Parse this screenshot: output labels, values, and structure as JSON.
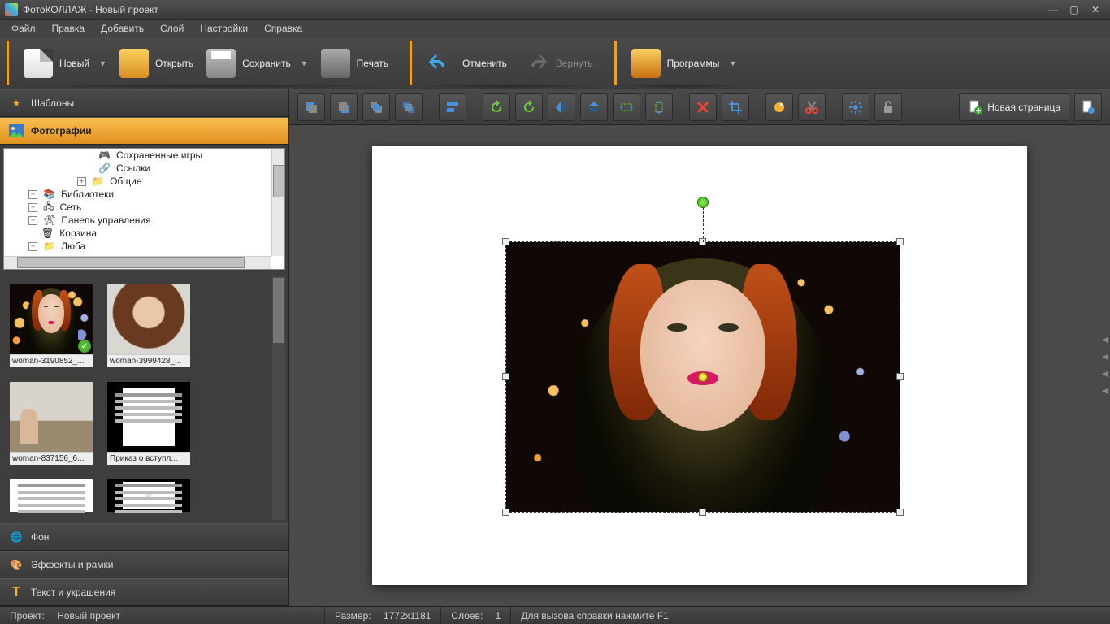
{
  "titlebar": {
    "app": "ФотоКОЛЛАЖ",
    "project": "Новый проект"
  },
  "menu": [
    "Файл",
    "Правка",
    "Добавить",
    "Слой",
    "Настройки",
    "Справка"
  ],
  "toolbar": {
    "new": "Новый",
    "open": "Открыть",
    "save": "Сохранить",
    "print": "Печать",
    "undo": "Отменить",
    "redo": "Вернуть",
    "programs": "Программы"
  },
  "sidebar": {
    "templates": "Шаблоны",
    "photos": "Фотографии",
    "background": "Фон",
    "effects": "Эффекты и рамки",
    "text": "Текст и украшения"
  },
  "tree": {
    "saved_games": "Сохраненные игры",
    "links": "Ссылки",
    "shared": "Общие",
    "libraries": "Библиотеки",
    "network": "Сеть",
    "control_panel": "Панель управления",
    "recycle": "Корзина",
    "user": "Люба"
  },
  "thumbs": [
    {
      "caption": "woman-3190852_...",
      "badge": true
    },
    {
      "caption": "woman-3999428_..."
    },
    {
      "caption": "woman-837156_6..."
    },
    {
      "caption": "Приказ о вступл..."
    }
  ],
  "canvasbar": {
    "new_page": "Новая страница"
  },
  "statusbar": {
    "project_label": "Проект:",
    "project_name": "Новый проект",
    "size_label": "Размер:",
    "size_value": "1772x1181",
    "layers_label": "Слоев:",
    "layers_value": "1",
    "help": "Для вызова справки нажмите F1."
  }
}
